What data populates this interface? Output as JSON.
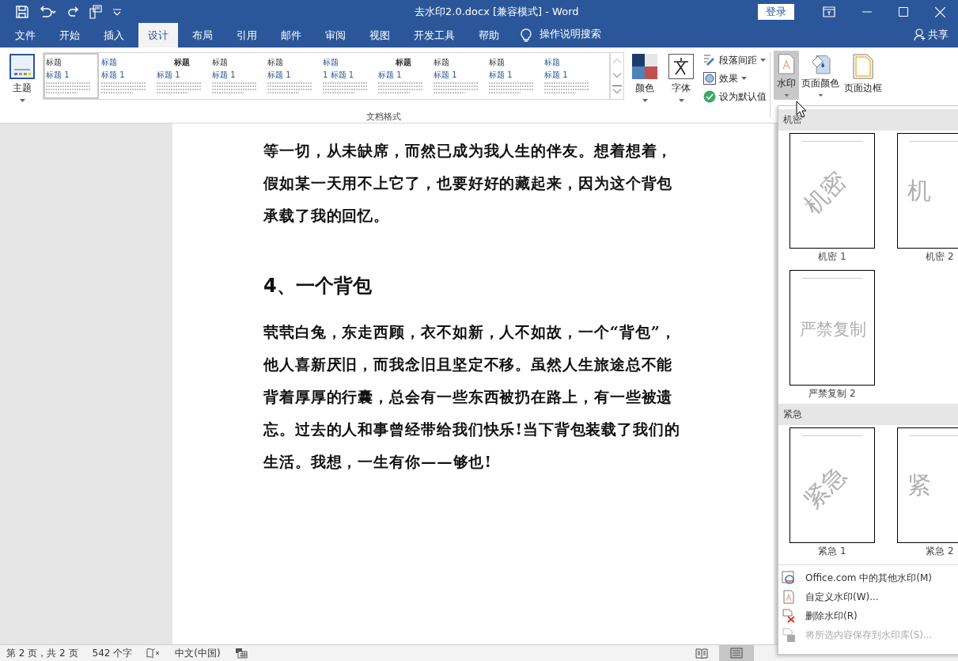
{
  "window": {
    "title": "去水印2.0.docx [兼容模式]  -  Word",
    "sign_in": "登录"
  },
  "tabs": [
    {
      "label": "文件",
      "selected": false
    },
    {
      "label": "开始",
      "selected": false
    },
    {
      "label": "插入",
      "selected": false
    },
    {
      "label": "设计",
      "selected": true
    },
    {
      "label": "布局",
      "selected": false
    },
    {
      "label": "引用",
      "selected": false
    },
    {
      "label": "邮件",
      "selected": false
    },
    {
      "label": "审阅",
      "selected": false
    },
    {
      "label": "视图",
      "selected": false
    },
    {
      "label": "开发工具",
      "selected": false
    },
    {
      "label": "帮助",
      "selected": false
    }
  ],
  "tell_me": "操作说明搜索",
  "share": "共享",
  "ribbon": {
    "theme": "主题",
    "styles": [
      {
        "title": "标题",
        "heading": "标题 1",
        "selected": true
      },
      {
        "title": "标题",
        "heading": "标题 1",
        "selected": false
      },
      {
        "title": "标题",
        "heading": "标题 1",
        "selected": false
      },
      {
        "title": "标题",
        "heading": "标题 1",
        "selected": false
      },
      {
        "title": "标题",
        "heading": "标题 1",
        "selected": false
      },
      {
        "title": "标题",
        "heading": "1  标题 1",
        "selected": false
      },
      {
        "title": "标题",
        "heading": "标题 1",
        "selected": false
      },
      {
        "title": "标题",
        "heading": "标题 1",
        "selected": false
      },
      {
        "title": "标题",
        "heading": "标题 1",
        "selected": false
      },
      {
        "title": "标题",
        "heading": "标题 1",
        "selected": false
      }
    ],
    "colors": "颜色",
    "fonts": "字体",
    "options": [
      {
        "kind": "spacing",
        "label": "段落间距",
        "has_menu": true
      },
      {
        "kind": "effects",
        "label": "效果",
        "has_menu": true
      },
      {
        "kind": "default",
        "label": "设为默认值",
        "has_menu": false
      }
    ],
    "group_label": "文档格式",
    "page_background": [
      {
        "kind": "watermark",
        "label": "水印",
        "pressed": true
      },
      {
        "kind": "color",
        "label": "页面颜色",
        "pressed": false
      },
      {
        "kind": "border",
        "label": "页面边框",
        "pressed": false
      }
    ]
  },
  "document": {
    "paragraphs": [
      {
        "kind": "body",
        "text": "等一切，从未缺席，而然已成为我人生的伴友。想着想着，假如某一天用不上它了，也要好好的藏起来，因为这个背包承载了我的回忆。"
      },
      {
        "kind": "heading",
        "text": "4、一个背包"
      },
      {
        "kind": "body",
        "text": "茕茕白兔，东走西顾，衣不如新，人不如故，一个“背包”，他人喜新厌旧，而我念旧且坚定不移。虽然人生旅途总不能背着厚厚的行囊，总会有一些东西被扔在路上，有一些被遗忘。过去的人和事曾经带给我们快乐!当下背包装载了我们的生活。我想，一生有你——够也!"
      }
    ]
  },
  "watermark_menu": {
    "sections": [
      {
        "title": "机密",
        "items": [
          {
            "label": "机密 1",
            "text": "机密",
            "kind": "diagonal"
          },
          {
            "label": "机密 2",
            "text": "机",
            "kind": "horizontal"
          },
          {
            "label": "严禁复制 2",
            "text": "严禁复制",
            "kind": "horizontal"
          }
        ]
      },
      {
        "title": "紧急",
        "items": [
          {
            "label": "紧急 1",
            "text": "紧急",
            "kind": "diagonal"
          },
          {
            "label": "紧急 2",
            "text": "紧",
            "kind": "horizontal"
          }
        ]
      }
    ],
    "actions": [
      {
        "kind": "office",
        "label": "Office.com 中的其他水印(M)",
        "disabled": false
      },
      {
        "kind": "custom",
        "label": "自定义水印(W)...",
        "disabled": false
      },
      {
        "kind": "remove",
        "label": "删除水印(R)",
        "disabled": false
      },
      {
        "kind": "save",
        "label": "将所选内容保存到水印库(S)...",
        "disabled": true
      }
    ]
  },
  "status_bar": {
    "page": "第 2 页，共 2 页",
    "words": "542 个字",
    "language": "中文(中国)",
    "views": [
      {
        "kind": "read",
        "selected": false
      },
      {
        "kind": "print",
        "selected": true
      }
    ]
  }
}
